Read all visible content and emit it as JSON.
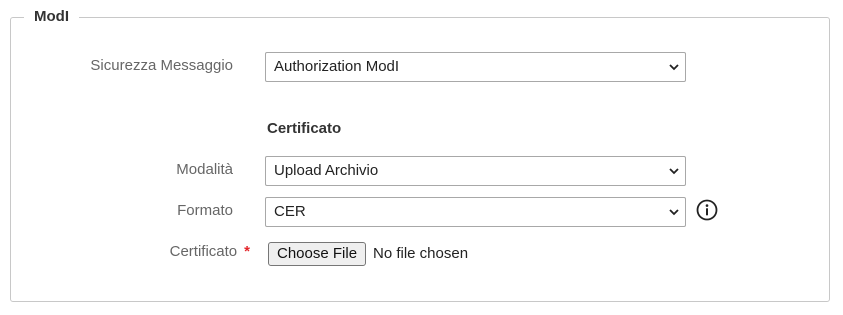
{
  "fieldset": {
    "legend": "ModI"
  },
  "sicurezza": {
    "label": "Sicurezza Messaggio",
    "value": "Authorization ModI"
  },
  "certificato_section": {
    "title": "Certificato"
  },
  "modalita": {
    "label": "Modalità",
    "value": "Upload Archivio"
  },
  "formato": {
    "label": "Formato",
    "value": "CER"
  },
  "certificato": {
    "label": "Certificato",
    "required_mark": "*",
    "button_label": "Choose File",
    "status": "No file chosen"
  },
  "colors": {
    "required": "#e3262b",
    "label": "#666666",
    "border": "#c8c8c8"
  },
  "icons": {
    "select": "chevron-down-icon",
    "info": "info-icon"
  }
}
